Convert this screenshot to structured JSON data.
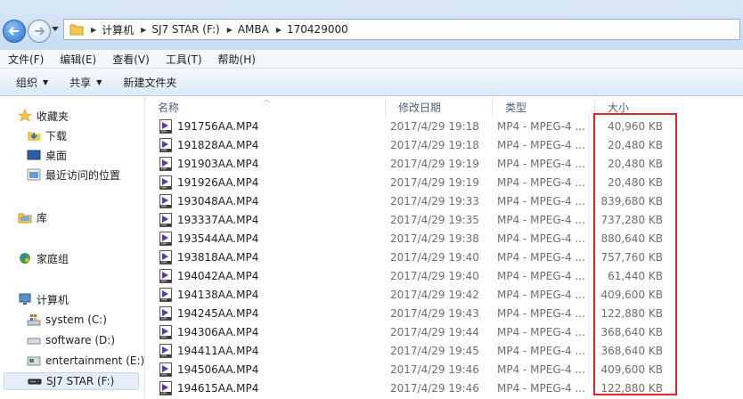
{
  "navigation": {
    "back_icon": "back-arrow-icon",
    "forward_icon": "forward-arrow-icon",
    "breadcrumb": [
      "计算机",
      "SJ7 STAR (F:)",
      "AMBA",
      "170429000"
    ]
  },
  "menu": [
    "文件(F)",
    "编辑(E)",
    "查看(V)",
    "工具(T)",
    "帮助(H)"
  ],
  "toolbar": {
    "organize": "组织",
    "share": "共享",
    "new_folder": "新建文件夹"
  },
  "sidebar": {
    "favorites": {
      "label": "收藏夹",
      "items": [
        "下载",
        "桌面",
        "最近访问的位置"
      ]
    },
    "library": "库",
    "homegroup": "家庭组",
    "computer": {
      "label": "计算机",
      "items": [
        "system (C:)",
        "software (D:)",
        "entertainment (E:)",
        "SJ7 STAR (F:)"
      ]
    }
  },
  "columns": {
    "name": "名称",
    "date": "修改日期",
    "type": "类型",
    "size": "大小"
  },
  "files": [
    {
      "name": "191756AA.MP4",
      "date": "2017/4/29 19:18",
      "type": "MP4 - MPEG-4 ...",
      "size": "40,960 KB"
    },
    {
      "name": "191828AA.MP4",
      "date": "2017/4/29 19:18",
      "type": "MP4 - MPEG-4 ...",
      "size": "20,480 KB"
    },
    {
      "name": "191903AA.MP4",
      "date": "2017/4/29 19:19",
      "type": "MP4 - MPEG-4 ...",
      "size": "20,480 KB"
    },
    {
      "name": "191926AA.MP4",
      "date": "2017/4/29 19:19",
      "type": "MP4 - MPEG-4 ...",
      "size": "20,480 KB"
    },
    {
      "name": "193048AA.MP4",
      "date": "2017/4/29 19:33",
      "type": "MP4 - MPEG-4 ...",
      "size": "839,680 KB"
    },
    {
      "name": "193337AA.MP4",
      "date": "2017/4/29 19:35",
      "type": "MP4 - MPEG-4 ...",
      "size": "737,280 KB"
    },
    {
      "name": "193544AA.MP4",
      "date": "2017/4/29 19:38",
      "type": "MP4 - MPEG-4 ...",
      "size": "880,640 KB"
    },
    {
      "name": "193818AA.MP4",
      "date": "2017/4/29 19:40",
      "type": "MP4 - MPEG-4 ...",
      "size": "757,760 KB"
    },
    {
      "name": "194042AA.MP4",
      "date": "2017/4/29 19:40",
      "type": "MP4 - MPEG-4 ...",
      "size": "61,440 KB"
    },
    {
      "name": "194138AA.MP4",
      "date": "2017/4/29 19:42",
      "type": "MP4 - MPEG-4 ...",
      "size": "409,600 KB"
    },
    {
      "name": "194245AA.MP4",
      "date": "2017/4/29 19:43",
      "type": "MP4 - MPEG-4 ...",
      "size": "122,880 KB"
    },
    {
      "name": "194306AA.MP4",
      "date": "2017/4/29 19:44",
      "type": "MP4 - MPEG-4 ...",
      "size": "368,640 KB"
    },
    {
      "name": "194411AA.MP4",
      "date": "2017/4/29 19:45",
      "type": "MP4 - MPEG-4 ...",
      "size": "368,640 KB"
    },
    {
      "name": "194506AA.MP4",
      "date": "2017/4/29 19:46",
      "type": "MP4 - MPEG-4 ...",
      "size": "409,600 KB"
    },
    {
      "name": "194615AA.MP4",
      "date": "2017/4/29 19:46",
      "type": "MP4 - MPEG-4 ...",
      "size": "122,880 KB"
    }
  ],
  "colors": {
    "highlight": "#e8212b",
    "header_text": "#4c607a"
  }
}
